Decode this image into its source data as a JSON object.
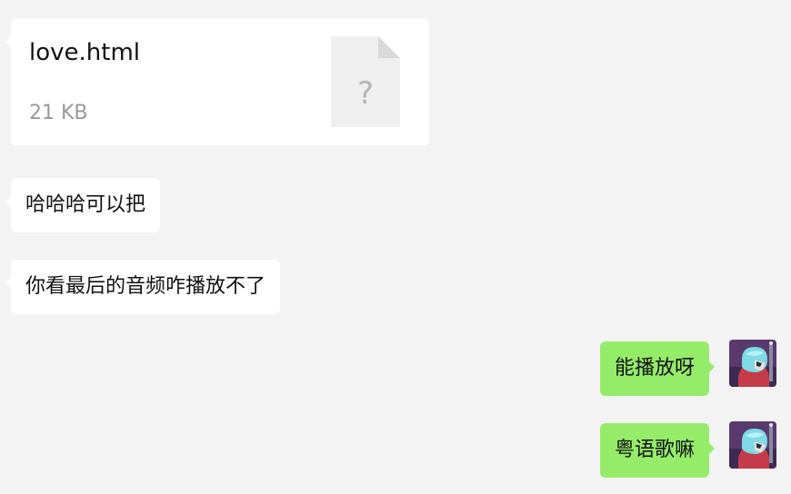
{
  "messages": [
    {
      "type": "file",
      "side": "left",
      "file_name": "love.html",
      "file_size": "21 KB",
      "icon_glyph": "?",
      "icon": "unknown-file-icon"
    },
    {
      "type": "text",
      "side": "left",
      "text": "哈哈哈可以把"
    },
    {
      "type": "text",
      "side": "left",
      "text": "你看最后的音频咋播放不了"
    },
    {
      "type": "text",
      "side": "right",
      "text": "能播放呀",
      "avatar": "user-avatar"
    },
    {
      "type": "text",
      "side": "right",
      "text": "粤语歌嘛",
      "avatar": "user-avatar"
    }
  ],
  "colors": {
    "background": "#f3f3f3",
    "incoming_bubble": "#ffffff",
    "outgoing_bubble": "#95ec69",
    "file_size_text": "#999999"
  }
}
